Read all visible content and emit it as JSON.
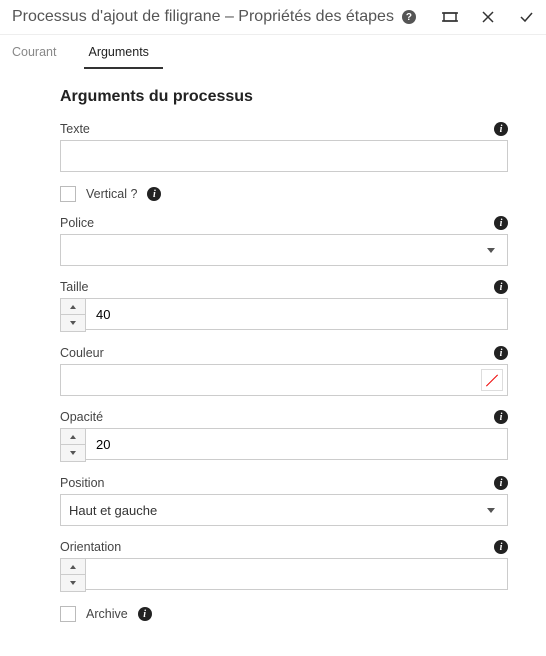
{
  "header": {
    "title": "Processus d'ajout de filigrane – Propriétés des étapes"
  },
  "tabs": {
    "common": "Courant",
    "arguments": "Arguments"
  },
  "form": {
    "section_title": "Arguments du processus",
    "texte": {
      "label": "Texte",
      "value": ""
    },
    "vertical": {
      "label": "Vertical ?"
    },
    "police": {
      "label": "Police",
      "value": ""
    },
    "taille": {
      "label": "Taille",
      "value": "40"
    },
    "couleur": {
      "label": "Couleur"
    },
    "opacite": {
      "label": "Opacité",
      "value": "20"
    },
    "position": {
      "label": "Position",
      "value": "Haut et gauche"
    },
    "orientation": {
      "label": "Orientation",
      "value": ""
    },
    "archive": {
      "label": "Archive"
    }
  }
}
